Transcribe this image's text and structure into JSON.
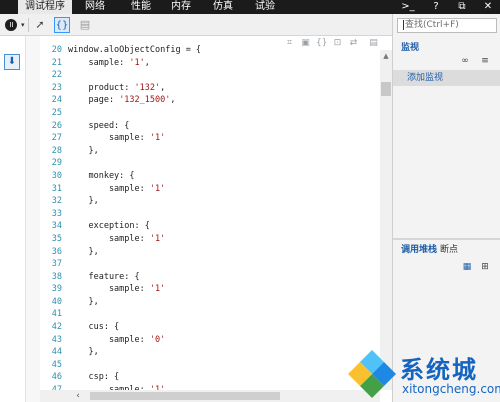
{
  "tabs": [
    "调试程序",
    "网络",
    "性能",
    "内存",
    "仿真",
    "试验"
  ],
  "active_tab": "调试程序",
  "window_controls": [
    "console-icon",
    "help-icon",
    "undock-icon",
    "close-icon"
  ],
  "window_control_glyphs": [
    ">_",
    "?",
    "⧉",
    "✕"
  ],
  "toolbar": {
    "pause_glyph": "II",
    "caret": "▾",
    "step_glyph": "➚",
    "exceptions_glyph": "{}",
    "comment_glyph": "▤"
  },
  "editor_icons": [
    "format-icon",
    "save-icon",
    "pretty-print-icon",
    "breakpoint-icon",
    "map-icon",
    "window-icon"
  ],
  "editor_icon_glyphs": [
    "⌗",
    "▣",
    "{}",
    "⊡",
    "⇄",
    "▤"
  ],
  "gutter": {
    "pin_glyph": "⬇"
  },
  "code_lines": [
    {
      "num": "20",
      "pre": "window.aloObjectConfig = {",
      "str": "",
      "post": ""
    },
    {
      "num": "21",
      "pre": "    sample: ",
      "str": "'1'",
      "post": ","
    },
    {
      "num": "22",
      "pre": "",
      "str": "",
      "post": ""
    },
    {
      "num": "23",
      "pre": "    product: ",
      "str": "'132'",
      "post": ","
    },
    {
      "num": "24",
      "pre": "    page: ",
      "str": "'132_1500'",
      "post": ","
    },
    {
      "num": "25",
      "pre": "",
      "str": "",
      "post": ""
    },
    {
      "num": "26",
      "pre": "    speed: {",
      "str": "",
      "post": ""
    },
    {
      "num": "27",
      "pre": "        sample: ",
      "str": "'1'",
      "post": ""
    },
    {
      "num": "28",
      "pre": "    },",
      "str": "",
      "post": ""
    },
    {
      "num": "29",
      "pre": "",
      "str": "",
      "post": ""
    },
    {
      "num": "30",
      "pre": "    monkey: {",
      "str": "",
      "post": ""
    },
    {
      "num": "31",
      "pre": "        sample: ",
      "str": "'1'",
      "post": ""
    },
    {
      "num": "32",
      "pre": "    },",
      "str": "",
      "post": ""
    },
    {
      "num": "33",
      "pre": "",
      "str": "",
      "post": ""
    },
    {
      "num": "34",
      "pre": "    exception: {",
      "str": "",
      "post": ""
    },
    {
      "num": "35",
      "pre": "        sample: ",
      "str": "'1'",
      "post": ""
    },
    {
      "num": "36",
      "pre": "    },",
      "str": "",
      "post": ""
    },
    {
      "num": "37",
      "pre": "",
      "str": "",
      "post": ""
    },
    {
      "num": "38",
      "pre": "    feature: {",
      "str": "",
      "post": ""
    },
    {
      "num": "39",
      "pre": "        sample: ",
      "str": "'1'",
      "post": ""
    },
    {
      "num": "40",
      "pre": "    },",
      "str": "",
      "post": ""
    },
    {
      "num": "41",
      "pre": "",
      "str": "",
      "post": ""
    },
    {
      "num": "42",
      "pre": "    cus: {",
      "str": "",
      "post": ""
    },
    {
      "num": "43",
      "pre": "        sample: ",
      "str": "'0'",
      "post": ""
    },
    {
      "num": "44",
      "pre": "    },",
      "str": "",
      "post": ""
    },
    {
      "num": "45",
      "pre": "",
      "str": "",
      "post": ""
    },
    {
      "num": "46",
      "pre": "    csp: {",
      "str": "",
      "post": ""
    },
    {
      "num": "47",
      "pre": "        sample: ",
      "str": "'1'",
      "post": ","
    }
  ],
  "scrollbar": {
    "up_glyph": "▲",
    "left_glyph": "‹"
  },
  "right_pane": {
    "search_placeholder": "查找(Ctrl+F)",
    "watch_title": "监视",
    "watch_btn_glyphs": [
      "∞",
      "≡"
    ],
    "add_watch": "添加监视",
    "call_stack_tab": "调用堆栈",
    "breakpoints_tab": "断点",
    "stack_btn_glyphs": [
      "▦",
      "⊞"
    ]
  },
  "watermark": {
    "name": "系统城",
    "url": "xitongcheng.com"
  },
  "colors": {
    "tab_bar": "#1b1b1c",
    "accent": "#1e5fa8",
    "string": "#a31515",
    "line_number": "#2b91af"
  }
}
